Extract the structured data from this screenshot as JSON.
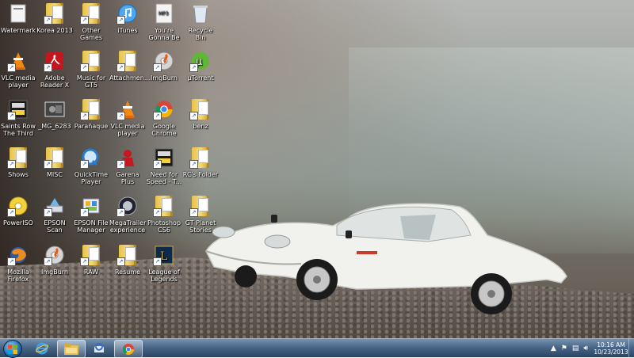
{
  "desktop": {
    "icons": [
      {
        "label": "Watermark",
        "icon": "watermark-icon"
      },
      {
        "label": "Korea 2013",
        "icon": "folder-icon"
      },
      {
        "label": "Other Games",
        "icon": "folder-icon"
      },
      {
        "label": "iTunes",
        "icon": "itunes-icon"
      },
      {
        "label": "You're Gonna Be",
        "icon": "mp3-file-icon"
      },
      {
        "label": "Recycle Bin",
        "icon": "recycle-bin-icon"
      },
      {
        "label": "VLC media player",
        "icon": "vlc-icon"
      },
      {
        "label": "Adobe Reader X",
        "icon": "adobe-reader-icon"
      },
      {
        "label": "Music for GT5",
        "icon": "folder-icon"
      },
      {
        "label": "Attachmen...",
        "icon": "folder-icon"
      },
      {
        "label": "ImgBurn",
        "icon": "imgburn-icon"
      },
      {
        "label": "µTorrent",
        "icon": "utorrent-icon"
      },
      {
        "label": "Saints Row The Third",
        "icon": "game-icon"
      },
      {
        "label": "_MG_6283",
        "icon": "photo-icon"
      },
      {
        "label": "Parañaque",
        "icon": "folder-icon"
      },
      {
        "label": "VLC media player",
        "icon": "vlc-icon"
      },
      {
        "label": "Google Chrome",
        "icon": "chrome-icon"
      },
      {
        "label": "benz",
        "icon": "folder-icon"
      },
      {
        "label": "Shows",
        "icon": "folder-icon"
      },
      {
        "label": "MISC",
        "icon": "folder-icon"
      },
      {
        "label": "QuickTime Player",
        "icon": "quicktime-icon"
      },
      {
        "label": "Garena Plus",
        "icon": "garena-icon"
      },
      {
        "label": "Need for Speed - T...",
        "icon": "game-icon"
      },
      {
        "label": "RC's Folder",
        "icon": "folder-icon"
      },
      {
        "label": "PowerISO",
        "icon": "poweriso-icon"
      },
      {
        "label": "EPSON Scan",
        "icon": "epson-scan-icon"
      },
      {
        "label": "EPSON File Manager",
        "icon": "epson-file-manager-icon"
      },
      {
        "label": "MegaTrailer experience",
        "icon": "megatrailer-icon"
      },
      {
        "label": "Photoshop CS6",
        "icon": "folder-icon"
      },
      {
        "label": "GT Planet Stories",
        "icon": "folder-icon"
      },
      {
        "label": "Mozilla Firefox",
        "icon": "firefox-icon"
      },
      {
        "label": "ImgBurn",
        "icon": "imgburn-icon"
      },
      {
        "label": "RAW",
        "icon": "folder-icon"
      },
      {
        "label": "Resume",
        "icon": "folder-icon"
      },
      {
        "label": "League of Legends",
        "icon": "league-of-legends-icon"
      }
    ]
  },
  "taskbar": {
    "start_icon": "windows-start-icon",
    "pinned": [
      {
        "name": "internet-explorer-icon"
      },
      {
        "name": "windows-explorer-icon"
      },
      {
        "name": "thunderbird-icon"
      },
      {
        "name": "chrome-icon"
      }
    ],
    "tray": {
      "time": "10:16 AM",
      "date": "10/23/2013"
    }
  },
  "colors": {
    "taskbar": "#3c5a7d",
    "folder": "#e8c24a",
    "car": "#f2f2f0"
  }
}
